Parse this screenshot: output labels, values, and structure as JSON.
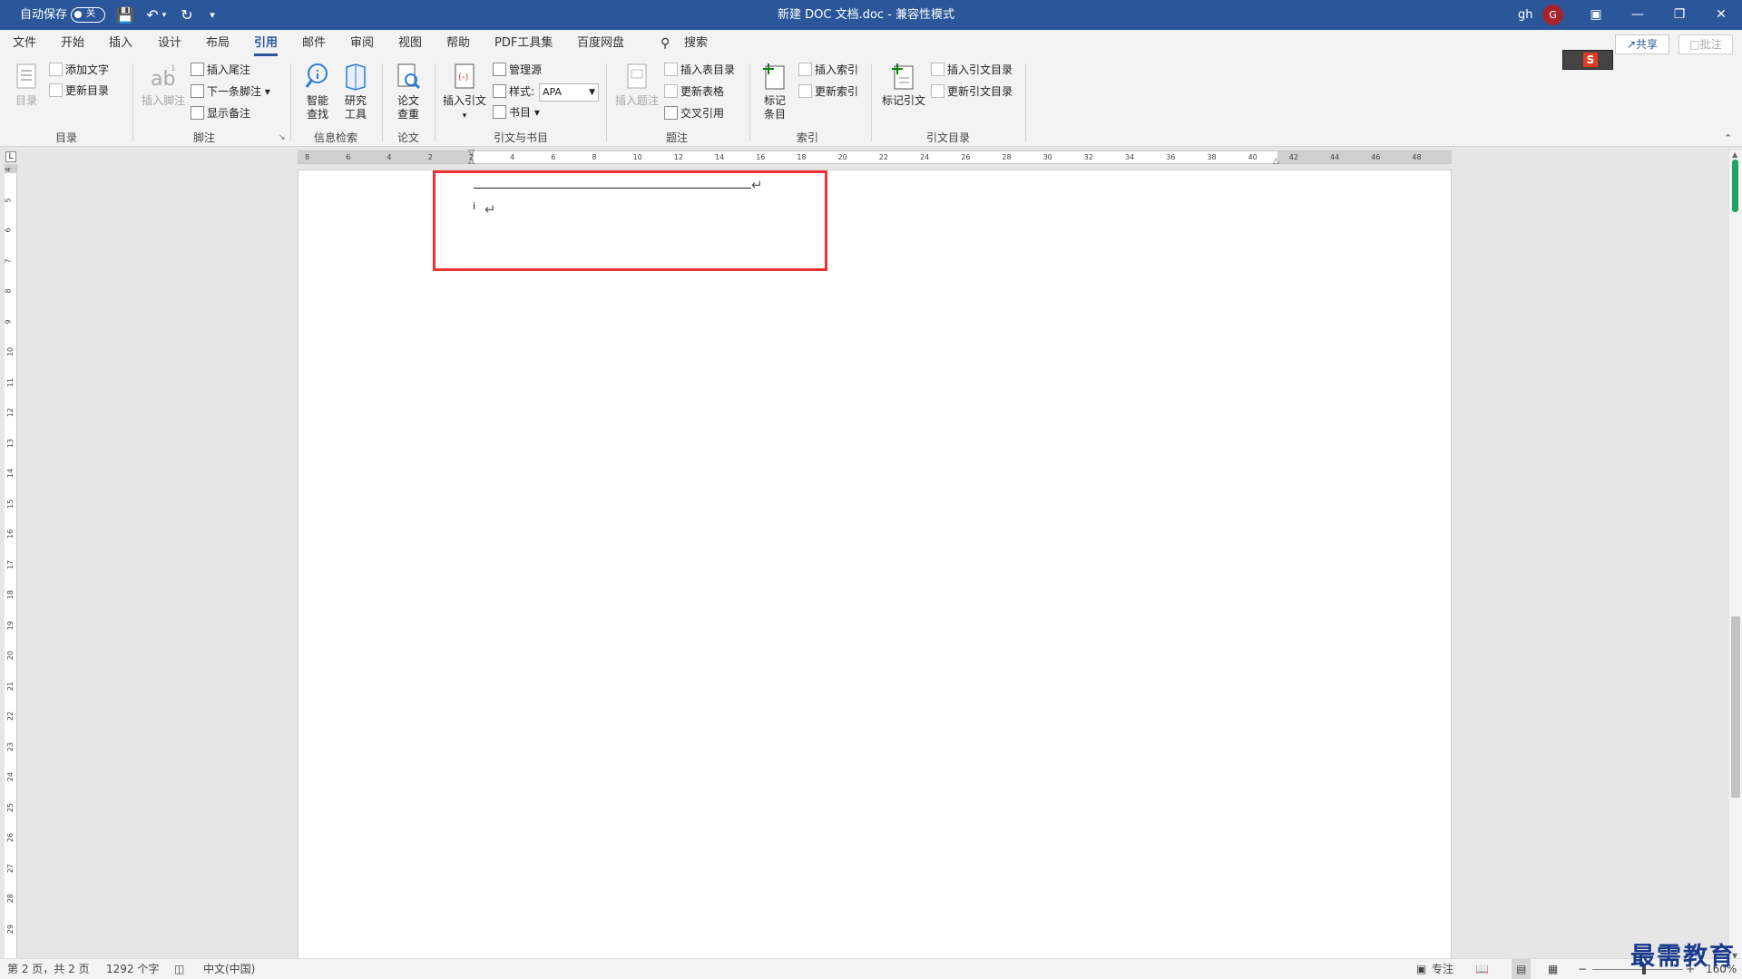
{
  "titlebar": {
    "autosave_label": "自动保存",
    "autosave_state": "关",
    "title": "新建 DOC 文档.doc  -  兼容性模式",
    "user": "gh",
    "avatar_letter": "G"
  },
  "menu": {
    "tabs": [
      "文件",
      "开始",
      "插入",
      "设计",
      "布局",
      "引用",
      "邮件",
      "审阅",
      "视图",
      "帮助",
      "PDF工具集",
      "百度网盘"
    ],
    "active": "引用",
    "search": "搜索",
    "share": "共享",
    "comment": "批注"
  },
  "ribbon": {
    "toc": {
      "big": "目录",
      "add_text": "添加文字",
      "update": "更新目录",
      "group": "目录"
    },
    "footnote": {
      "insert": "插入脚注",
      "endnote": "插入尾注",
      "next": "下一条脚注",
      "show": "显示备注",
      "group": "脚注"
    },
    "research": {
      "smart": "智能\n查找",
      "tools": "研究\n工具",
      "group": "信息检索"
    },
    "paper": {
      "check": "论文\n查重",
      "group": "论文"
    },
    "citation": {
      "insert": "插入引文",
      "manage": "管理源",
      "style_label": "样式:",
      "style_value": "APA",
      "biblio": "书目",
      "group": "引文与书目"
    },
    "caption": {
      "insert": "插入题注",
      "table_of_figures": "插入表目录",
      "update_table": "更新表格",
      "cross_ref": "交叉引用",
      "group": "题注"
    },
    "index": {
      "mark": "标记\n条目",
      "insert": "插入索引",
      "update": "更新索引",
      "group": "索引"
    },
    "authorities": {
      "mark": "标记引文",
      "insert": "插入引文目录",
      "update": "更新引文目录",
      "group": "引文目录"
    }
  },
  "ruler": {
    "h_labels": [
      "8",
      "6",
      "4",
      "2",
      "2",
      "4",
      "6",
      "8",
      "10",
      "12",
      "14",
      "16",
      "18",
      "20",
      "22",
      "24",
      "26",
      "28",
      "30",
      "32",
      "34",
      "36",
      "38",
      "40",
      "42",
      "44",
      "46",
      "48"
    ],
    "v_labels": [
      "4",
      "5",
      "6",
      "7",
      "8",
      "9",
      "10",
      "11",
      "12",
      "13",
      "14",
      "15",
      "16",
      "17",
      "18",
      "19",
      "20",
      "21",
      "22",
      "23",
      "24",
      "25",
      "26",
      "27",
      "28",
      "29"
    ]
  },
  "document": {
    "footnote_mark": "i"
  },
  "status": {
    "page": "第 2 页，共 2 页",
    "words": "1292 个字",
    "language": "中文(中国)",
    "focus": "专注",
    "zoom": "160%"
  },
  "watermark": "最需教育"
}
